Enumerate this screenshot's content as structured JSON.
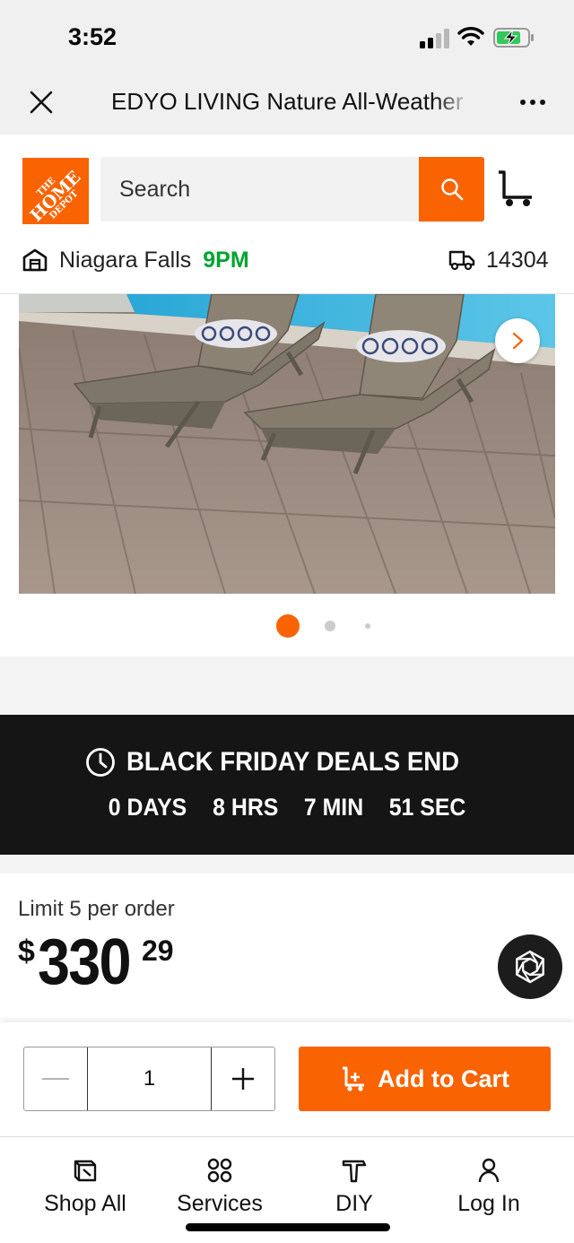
{
  "status_bar": {
    "time": "3:52",
    "icons": [
      "cellular-signal-icon",
      "wifi-icon",
      "battery-charging-icon"
    ]
  },
  "browser": {
    "page_title": "EDYO LIVING Nature All-Weather",
    "close_icon": "close-icon",
    "more_icon": "more-options-icon"
  },
  "header": {
    "logo_lines": [
      "THE",
      "HOME",
      "DEPOT"
    ],
    "search_placeholder": "Search",
    "search_icon": "search-icon",
    "cart_icon": "cart-icon",
    "store_icon": "store-icon",
    "store_name": "Niagara Falls",
    "store_closing_time": "9PM",
    "delivery_icon": "delivery-truck-icon",
    "zip_code": "14304"
  },
  "gallery": {
    "image_description_icon": "product-image",
    "next_icon": "chevron-right-icon",
    "total_images": 3,
    "active_index": 0
  },
  "deal_banner": {
    "clock_icon": "clock-icon",
    "title": "BLACK FRIDAY DEALS END",
    "countdown": {
      "days": "0 DAYS",
      "hours": "8 HRS",
      "minutes": "7 MIN",
      "seconds": "51 SEC"
    }
  },
  "price": {
    "limit": "Limit 5 per order",
    "currency": "$",
    "dollars": "330",
    "cents": "29"
  },
  "cart_bar": {
    "quantity": "1",
    "add_to_cart_label": "Add to Cart"
  },
  "bottom_nav": {
    "items": [
      {
        "label": "Shop All",
        "icon": "shop-all-icon"
      },
      {
        "label": "Services",
        "icon": "services-icon"
      },
      {
        "label": "DIY",
        "icon": "diy-hammer-icon"
      },
      {
        "label": "Log In",
        "icon": "user-icon"
      }
    ]
  },
  "colors": {
    "brand_orange": "#f96302",
    "store_time_green": "#00a330",
    "banner_black": "#151515"
  }
}
